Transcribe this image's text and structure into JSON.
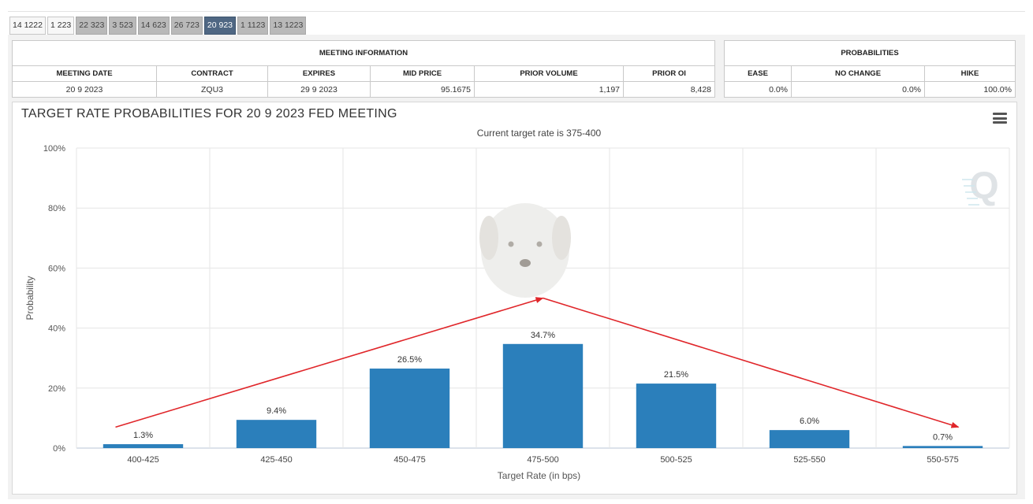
{
  "tabs": [
    "14 1222",
    "1 223",
    "22 323",
    "3 523",
    "14 623",
    "26 723",
    "20 923",
    "1 1123",
    "13 1223"
  ],
  "active_tab": "20 923",
  "meeting_info": {
    "section_title": "MEETING INFORMATION",
    "headers": [
      "MEETING DATE",
      "CONTRACT",
      "EXPIRES",
      "MID PRICE",
      "PRIOR VOLUME",
      "PRIOR OI"
    ],
    "values": [
      "20 9 2023",
      "ZQU3",
      "29 9 2023",
      "95.1675",
      "1,197",
      "8,428"
    ]
  },
  "probabilities": {
    "section_title": "PROBABILITIES",
    "headers": [
      "EASE",
      "NO CHANGE",
      "HIKE"
    ],
    "values": [
      "0.0%",
      "0.0%",
      "100.0%"
    ]
  },
  "chart_data": {
    "type": "bar",
    "title": "TARGET RATE PROBABILITIES FOR 20 9 2023 FED MEETING",
    "subtitle": "Current target rate is 375-400",
    "xlabel": "Target Rate (in bps)",
    "ylabel": "Probability",
    "categories": [
      "400-425",
      "425-450",
      "450-475",
      "475-500",
      "500-525",
      "525-550",
      "550-575"
    ],
    "values": [
      1.3,
      9.4,
      26.5,
      34.7,
      21.5,
      6.0,
      0.7
    ],
    "data_labels": [
      "1.3%",
      "9.4%",
      "26.5%",
      "34.7%",
      "21.5%",
      "6.0%",
      "0.7%"
    ],
    "ylim": [
      0,
      100
    ],
    "yticks": [
      0,
      20,
      40,
      60,
      80,
      100
    ],
    "ytick_labels": [
      "0%",
      "20%",
      "40%",
      "60%",
      "80%",
      "100%"
    ],
    "grid": true,
    "bar_color": "#2b7fbb",
    "annotation_arrows": {
      "color": "#e0262a",
      "segments": [
        {
          "from": [
            "400-425",
            7
          ],
          "to": [
            "475-500",
            50
          ]
        },
        {
          "from": [
            "475-500",
            50
          ],
          "to": [
            "550-575",
            7
          ]
        }
      ]
    }
  }
}
